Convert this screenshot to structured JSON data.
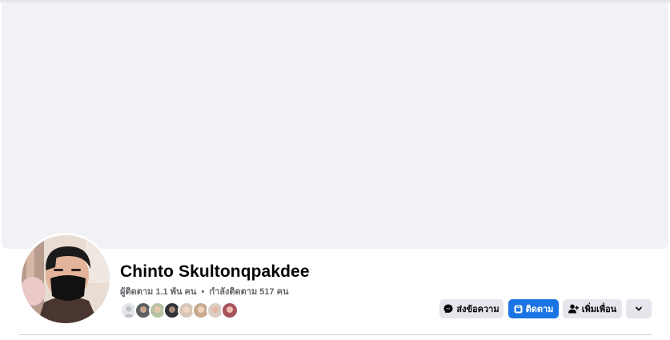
{
  "profile": {
    "name": "Chinto Skultonqpakdee",
    "followers_text": "ผู้ติดตาม 1.1 พัน คน",
    "separator": "•",
    "following_text": "กำลังติดตาม 517 คน"
  },
  "friend_avatars": [
    {
      "color": "#e4e6eb"
    },
    {
      "color": "#5b5f63"
    },
    {
      "color": "#b7c4a3"
    },
    {
      "color": "#2f3236"
    },
    {
      "color": "#d8c7b8"
    },
    {
      "color": "#c9a98e"
    },
    {
      "color": "#d9cfc4"
    },
    {
      "color": "#a8525d"
    }
  ],
  "actions": {
    "message_label": "ส่งข้อความ",
    "follow_label": "ติดตาม",
    "add_friend_label": "เพิ่มเพื่อน"
  },
  "colors": {
    "accent": "#1b74e4",
    "cover": "#f0f2f5",
    "button_gray": "#e4e6eb",
    "secondary_text": "#65676b"
  }
}
